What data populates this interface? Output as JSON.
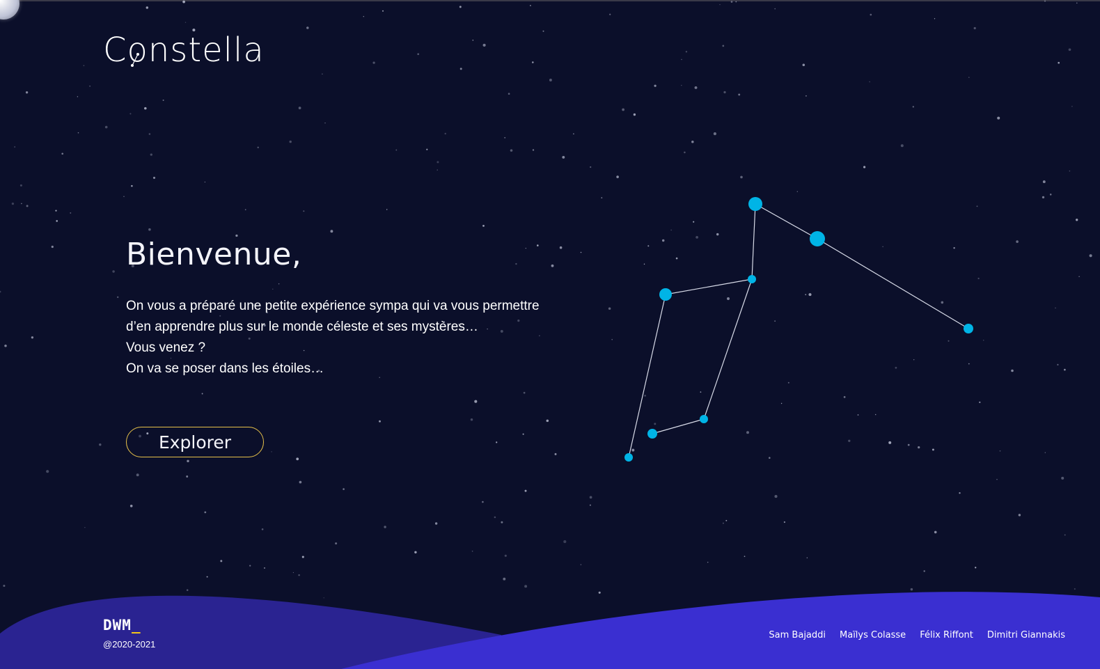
{
  "header": {
    "logo_text": "Constella"
  },
  "hero": {
    "title": "Bienvenue,",
    "lines": [
      "On vous a préparé une petite expérience sympa qui va vous permettre",
      "d’en apprendre plus sur le monde céleste et ses mystères…",
      "Vous venez ?",
      "On va se poser dans les étoiles…"
    ],
    "cta_label": "Explorer"
  },
  "footer": {
    "brand": "DWM",
    "brand_cursor": "_",
    "copyright": "@2020-2021",
    "credits": [
      "Sam Bajaddi",
      "Maïlys Colasse",
      "Félix Riffont",
      "Dimitri Giannakis"
    ]
  },
  "colors": {
    "background": "#0b0f2a",
    "accent_star": "#00b4e6",
    "button_border": "#e8c24a",
    "wave_dark": "#2a2391",
    "wave_light": "#3a2fd1",
    "brand_cursor": "#f5c518"
  },
  "icons": {
    "corner": "moon-icon",
    "logo_mark": "constellation-mark-icon"
  }
}
